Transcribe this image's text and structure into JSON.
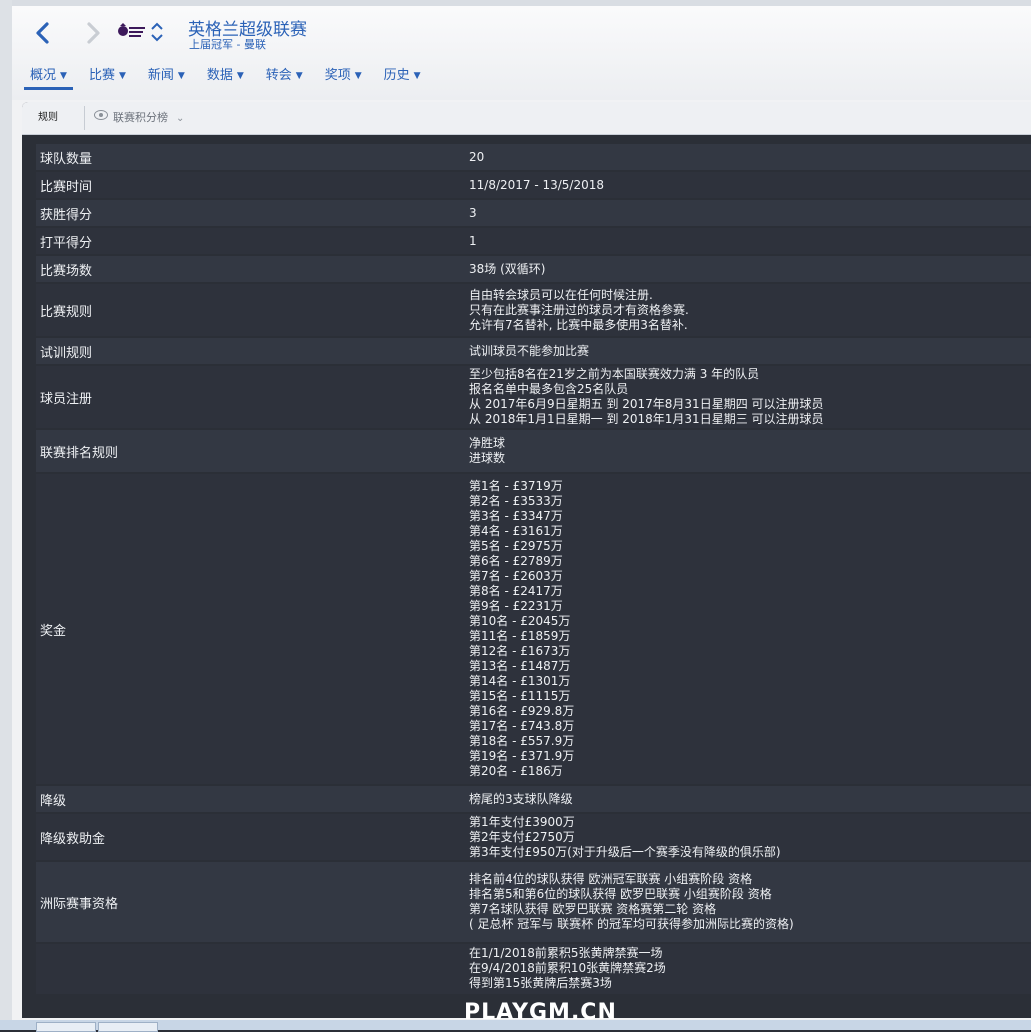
{
  "header": {
    "title": "英格兰超级联赛",
    "subtitle": "上届冠军 - 曼联",
    "logo_icon": "premier-league-logo",
    "accent_color": "#2b62b7"
  },
  "tabs": [
    {
      "label": "概况",
      "active": true
    },
    {
      "label": "比赛"
    },
    {
      "label": "新闻"
    },
    {
      "label": "数据"
    },
    {
      "label": "转会"
    },
    {
      "label": "奖项"
    },
    {
      "label": "历史"
    }
  ],
  "subbar": {
    "rules_label": "规则",
    "league_table_label": "联赛积分榜"
  },
  "rows": [
    {
      "label": "球队数量",
      "lines": [
        "20"
      ]
    },
    {
      "label": "比赛时间",
      "lines": [
        "11/8/2017 - 13/5/2018"
      ]
    },
    {
      "label": "获胜得分",
      "lines": [
        "3"
      ]
    },
    {
      "label": "打平得分",
      "lines": [
        "1"
      ]
    },
    {
      "label": "比赛场数",
      "lines": [
        "38场 (双循环)"
      ]
    },
    {
      "label": "比赛规则",
      "lines": [
        "自由转会球员可以在任何时候注册.",
        "只有在此赛事注册过的球员才有资格参赛.",
        "允许有7名替补, 比赛中最多使用3名替补."
      ]
    },
    {
      "label": "试训规则",
      "lines": [
        "试训球员不能参加比赛"
      ]
    },
    {
      "label": "球员注册",
      "lines": [
        "至少包括8名在21岁之前为本国联赛效力满 3 年的队员",
        "报名名单中最多包含25名队员",
        "从 2017年6月9日星期五 到 2017年8月31日星期四 可以注册球员",
        "从 2018年1月1日星期一 到 2018年1月31日星期三 可以注册球员"
      ]
    },
    {
      "label": "联赛排名规则",
      "lines": [
        "净胜球",
        "进球数"
      ]
    },
    {
      "label": "奖金",
      "lines": [
        "第1名 - £3719万",
        "第2名 - £3533万",
        "第3名 - £3347万",
        "第4名 - £3161万",
        "第5名 - £2975万",
        "第6名 - £2789万",
        "第7名 - £2603万",
        "第8名 - £2417万",
        "第9名 - £2231万",
        "第10名 - £2045万",
        "第11名 - £1859万",
        "第12名 - £1673万",
        "第13名 - £1487万",
        "第14名 - £1301万",
        "第15名 - £1115万",
        "第16名 - £929.8万",
        "第17名 - £743.8万",
        "第18名 - £557.9万",
        "第19名 - £371.9万",
        "第20名 - £186万"
      ]
    },
    {
      "label": "降级",
      "lines": [
        "榜尾的3支球队降级"
      ]
    },
    {
      "label": "降级救助金",
      "lines": [
        "第1年支付£3900万",
        "第2年支付£2750万",
        "第3年支付£950万(对于升级后一个赛季没有降级的俱乐部)"
      ]
    },
    {
      "label": "洲际赛事资格",
      "lines": [
        "排名前4位的球队获得 欧洲冠军联赛 小组赛阶段 资格",
        "排名第5和第6位的球队获得 欧罗巴联赛 小组赛阶段 资格",
        "第7名球队获得 欧罗巴联赛 资格赛第二轮 资格",
        "( 足总杯 冠军与 联赛杯 的冠军均可获得参加洲际比赛的资格)"
      ]
    },
    {
      "label": "",
      "lines": [
        "在1/1/2018前累积5张黄牌禁赛一场",
        "在9/4/2018前累积10张黄牌禁赛2场",
        "得到第15张黄牌后禁赛3场"
      ]
    }
  ],
  "watermark": "PLAYGM.CN"
}
